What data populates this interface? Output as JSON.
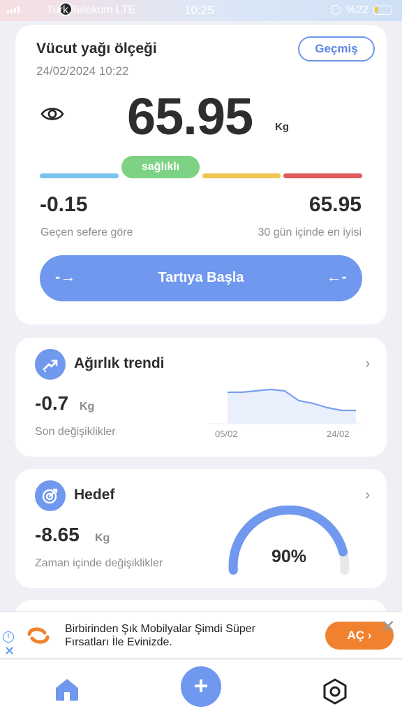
{
  "status_bar": {
    "carrier": "Türk Telekom  LTE",
    "time": "10:25",
    "battery": "%22"
  },
  "main": {
    "title": "Vücut yağı ölçeği",
    "datetime": "24/02/2024 10:22",
    "history_label": "Geçmiş",
    "weight_value": "65.95",
    "weight_unit": "Kg",
    "status_label": "sağlıklı",
    "change_value": "-0.15",
    "change_label": "Geçen sefere göre",
    "best_value": "65.95",
    "best_label": "30 gün içinde en iyisi",
    "start_label": "Tartıya Başla",
    "start_arrow_left": "-→",
    "start_arrow_right": "←-",
    "scale_colors": [
      "#79c4ee",
      "#7dd383",
      "#f2c451",
      "#e05a5e"
    ]
  },
  "trend": {
    "title": "Ağırlık trendi",
    "value": "-0.7",
    "unit": "Kg",
    "label": "Son değişiklikler",
    "chart_data": {
      "type": "line",
      "x_start": "05/02",
      "x_end": "24/02",
      "values": [
        66.6,
        66.6,
        66.65,
        66.7,
        66.65,
        66.3,
        66.2,
        66.05,
        65.95,
        65.95
      ],
      "ylim": [
        65.5,
        67.0
      ],
      "color": "#7aa0ef"
    }
  },
  "goal": {
    "title": "Hedef",
    "value": "-8.65",
    "unit": "Kg",
    "label": "Zaman içinde değişiklikler",
    "percent_label": "90%",
    "percent": 0.9,
    "color": "#6f98ee"
  },
  "ad": {
    "text": "Birbirinden Şık Mobilyalar Şimdi Süper Fırsatları İle Evinizde.",
    "cta": "AÇ ›",
    "info_icon": "info-icon",
    "close_icon": "close-icon"
  },
  "tabs": {
    "home_icon": "home-icon",
    "add_label": "+",
    "settings_icon": "settings-icon"
  }
}
